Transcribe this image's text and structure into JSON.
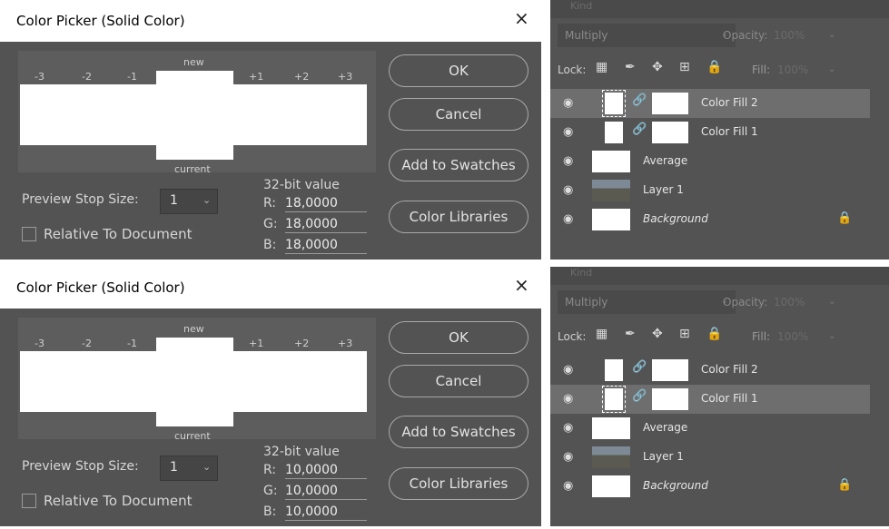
{
  "panels": [
    {
      "dialog": {
        "title": "Color Picker (Solid Color)",
        "close_icon": "×",
        "stops": [
          "-3",
          "-2",
          "-1",
          "+1",
          "+2",
          "+3"
        ],
        "label_new": "new",
        "label_current": "current",
        "preview_stop_size_label": "Preview Stop Size:",
        "preview_stop_size_value": "1",
        "relative_label": "Relative To Document",
        "bit_value_label": "32-bit value",
        "r_label": "R:",
        "r_value": "18,0000",
        "g_label": "G:",
        "g_value": "18,0000",
        "b_label": "B:",
        "b_value": "18,0000",
        "buttons": {
          "ok": "OK",
          "cancel": "Cancel",
          "add_to_swatches": "Add to Swatches",
          "color_libraries": "Color Libraries"
        }
      },
      "layers": {
        "kind_label": "Kind",
        "blend_mode": "Multiply",
        "opacity_label": "Opacity:",
        "opacity_value": "100%",
        "lock_label": "Lock:",
        "fill_label": "Fill:",
        "fill_value": "100%",
        "rows": [
          {
            "name": "Color Fill 2",
            "selected": true
          },
          {
            "name": "Color Fill 1",
            "selected": false
          },
          {
            "name": "Average",
            "selected": false
          },
          {
            "name": "Layer 1",
            "selected": false
          },
          {
            "name": "Background",
            "selected": false
          }
        ]
      }
    },
    {
      "dialog": {
        "title": "Color Picker (Solid Color)",
        "close_icon": "×",
        "stops": [
          "-3",
          "-2",
          "-1",
          "+1",
          "+2",
          "+3"
        ],
        "label_new": "new",
        "label_current": "current",
        "preview_stop_size_label": "Preview Stop Size:",
        "preview_stop_size_value": "1",
        "relative_label": "Relative To Document",
        "bit_value_label": "32-bit value",
        "r_label": "R:",
        "r_value": "10,0000",
        "g_label": "G:",
        "g_value": "10,0000",
        "b_label": "B:",
        "b_value": "10,0000",
        "buttons": {
          "ok": "OK",
          "cancel": "Cancel",
          "add_to_swatches": "Add to Swatches",
          "color_libraries": "Color Libraries"
        }
      },
      "layers": {
        "kind_label": "Kind",
        "blend_mode": "Multiply",
        "opacity_label": "Opacity:",
        "opacity_value": "100%",
        "lock_label": "Lock:",
        "fill_label": "Fill:",
        "fill_value": "100%",
        "rows": [
          {
            "name": "Color Fill 2",
            "selected": false
          },
          {
            "name": "Color Fill 1",
            "selected": true
          },
          {
            "name": "Average",
            "selected": false
          },
          {
            "name": "Layer 1",
            "selected": false
          },
          {
            "name": "Background",
            "selected": false
          }
        ]
      }
    }
  ]
}
